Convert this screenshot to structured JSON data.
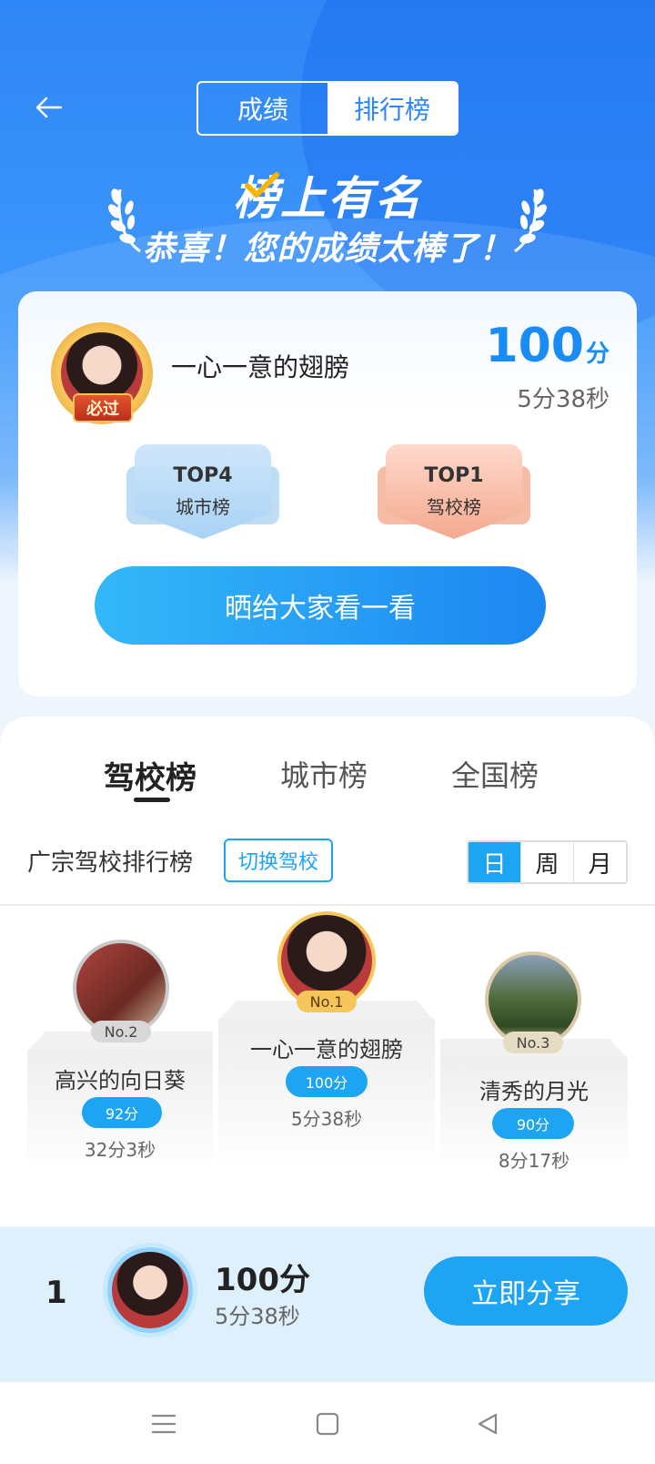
{
  "header": {
    "tabs": [
      {
        "label": "成绩",
        "active": false
      },
      {
        "label": "排行榜",
        "active": true
      }
    ],
    "banner_title": "榜上有名",
    "banner_subtitle": "恭喜！您的成绩太棒了！",
    "back_icon": "arrow-left-icon"
  },
  "result_card": {
    "name": "一心一意的翅膀",
    "badge": "必过",
    "score": "100",
    "score_unit": "分",
    "time": "5分38秒",
    "ranks": [
      {
        "rank": "TOP4",
        "board": "城市榜"
      },
      {
        "rank": "TOP1",
        "board": "驾校榜"
      }
    ],
    "share_button": "晒给大家看一看"
  },
  "board": {
    "tabs": [
      {
        "label": "驾校榜",
        "active": true
      },
      {
        "label": "城市榜",
        "active": false
      },
      {
        "label": "全国榜",
        "active": false
      }
    ],
    "title": "广宗驾校排行榜",
    "switch_button": "切换驾校",
    "periods": [
      {
        "label": "日",
        "active": true
      },
      {
        "label": "周",
        "active": false
      },
      {
        "label": "月",
        "active": false
      }
    ],
    "podium": {
      "first": {
        "tag": "No.1",
        "name": "一心一意的翅膀",
        "score": "100分",
        "time": "5分38秒"
      },
      "second": {
        "tag": "No.2",
        "name": "高兴的向日葵",
        "score": "92分",
        "time": "32分3秒"
      },
      "third": {
        "tag": "No.3",
        "name": "清秀的月光",
        "score": "90分",
        "time": "8分17秒"
      }
    }
  },
  "my_rank": {
    "rank": "1",
    "score": "100分",
    "time": "5分38秒",
    "share_button": "立即分享"
  },
  "colors": {
    "primary_blue": "#1da4f3",
    "hero_blue": "#2f86f6",
    "score_blue": "#1a8cf5"
  },
  "system_nav": [
    "menu-icon",
    "home-square-icon",
    "back-triangle-icon"
  ]
}
